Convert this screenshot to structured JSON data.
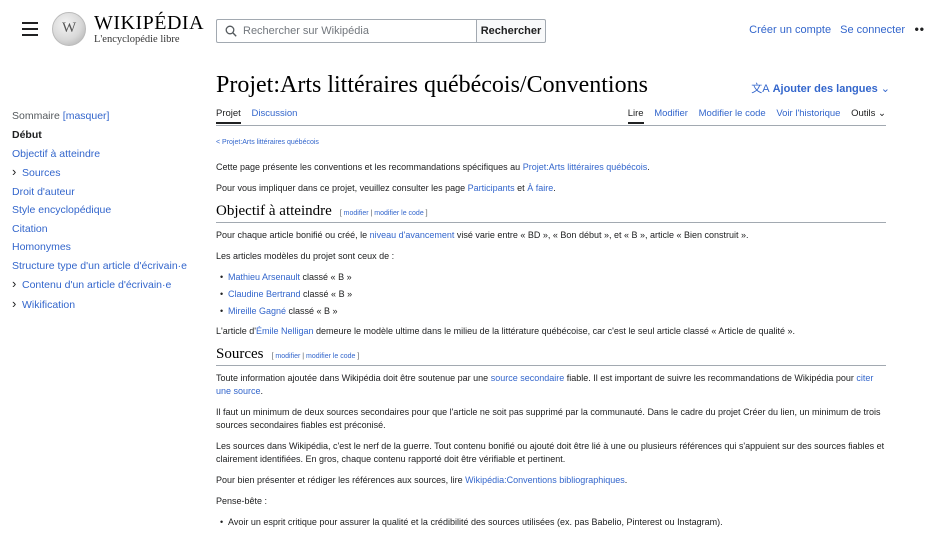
{
  "header": {
    "wordmark": "WIKIPÉDIA",
    "tagline": "L'encyclopédie libre",
    "search_placeholder": "Rechercher sur Wikipédia",
    "search_button": "Rechercher",
    "create_account": "Créer un compte",
    "login": "Se connecter",
    "more": "••"
  },
  "toc": {
    "title": "Sommaire",
    "hide": "[masquer]",
    "items": [
      {
        "label": "Début",
        "current": true,
        "expandable": false
      },
      {
        "label": "Objectif à atteindre",
        "current": false,
        "expandable": false
      },
      {
        "label": "Sources",
        "current": false,
        "expandable": true
      },
      {
        "label": "Droit d'auteur",
        "current": false,
        "expandable": false
      },
      {
        "label": "Style encyclopédique",
        "current": false,
        "expandable": false
      },
      {
        "label": "Citation",
        "current": false,
        "expandable": false
      },
      {
        "label": "Homonymes",
        "current": false,
        "expandable": false
      },
      {
        "label": "Structure type d'un article d'écrivain·e",
        "current": false,
        "expandable": false
      },
      {
        "label": "Contenu d'un article d'écrivain·e",
        "current": false,
        "expandable": true
      },
      {
        "label": "Wikification",
        "current": false,
        "expandable": true
      }
    ]
  },
  "page": {
    "title": "Projet:Arts littéraires québécois/Conventions",
    "lang_icon": "文A",
    "lang_button": "Ajouter des langues",
    "tabs_left": [
      "Projet",
      "Discussion"
    ],
    "tabs_right": [
      "Lire",
      "Modifier",
      "Modifier le code",
      "Voir l'historique",
      "Outils"
    ]
  },
  "content": {
    "breadcrumb": "< Projet:Arts littéraires québécois",
    "intro1_pre": "Cette page présente les conventions et les recommandations spécifiques au ",
    "intro1_link": "Projet:Arts littéraires québécois",
    "intro1_post": ".",
    "intro2_pre": "Pour vous impliquer dans ce projet, veuillez consulter les page ",
    "intro2_link1": "Participants",
    "intro2_mid": " et ",
    "intro2_link2": "À faire",
    "intro2_post": ".",
    "edit_open": "[ ",
    "edit_modifier": "modifier",
    "edit_sep": " | ",
    "edit_code": "modifier le code",
    "edit_close": " ]",
    "s1_title": "Objectif à atteindre",
    "s1_p1_pre": "Pour chaque article bonifié ou créé, le ",
    "s1_p1_link": "niveau d'avancement",
    "s1_p1_post": " visé varie entre « BD », « Bon début », et « B », article « Bien construit ».",
    "s1_p2": "Les articles modèles du projet sont ceux de :",
    "models": [
      {
        "name": "Mathieu Arsenault",
        "rest": " classé « B »"
      },
      {
        "name": "Claudine Bertrand",
        "rest": " classé « B »"
      },
      {
        "name": "Mireille Gagné",
        "rest": " classé « B »"
      }
    ],
    "s1_p3_pre": "L'article d'",
    "s1_p3_link": "Émile Nelligan",
    "s1_p3_post": " demeure le modèle ultime dans le milieu de la littérature québécoise, car c'est le seul article classé « Article de qualité ».",
    "s2_title": "Sources",
    "s2_p1_pre": "Toute information ajoutée dans Wikipédia doit être soutenue par une ",
    "s2_p1_link": "source secondaire",
    "s2_p1_mid": " fiable. Il est important de suivre les recommandations de Wikipédia pour ",
    "s2_p1_link2": "citer une source",
    "s2_p1_post": ".",
    "s2_p2": "Il faut un minimum de deux sources secondaires pour que l'article ne soit pas supprimé par la communauté. Dans le cadre du projet Créer du lien, un minimum de trois sources secondaires fiables est préconisé.",
    "s2_p3": "Les sources dans Wikipédia, c'est le nerf de la guerre. Tout contenu bonifié ou ajouté doit être lié à une ou plusieurs références qui s'appuient sur des sources fiables et clairement identifiées. En gros, chaque contenu rapporté doit être vérifiable et pertinent.",
    "s2_p4_pre": "Pour bien présenter et rédiger les références aux sources, lire ",
    "s2_p4_link": "Wikipédia:Conventions bibliographiques",
    "s2_p4_post": ".",
    "s2_p5": "Pense-bête :",
    "s2_bullet1": "Avoir un esprit critique pour assurer la qualité et la crédibilité des sources utilisées (ex. pas Babelio, Pinterest ou Instagram)."
  },
  "colors": {
    "link": "#3366cc",
    "text": "#202122",
    "border": "#a2a9b1"
  },
  "icons": [
    "hamburger-menu-icon",
    "wikipedia-globe-logo",
    "search-icon",
    "translate-icon",
    "chevron-down-icon",
    "chevron-right-icon"
  ]
}
